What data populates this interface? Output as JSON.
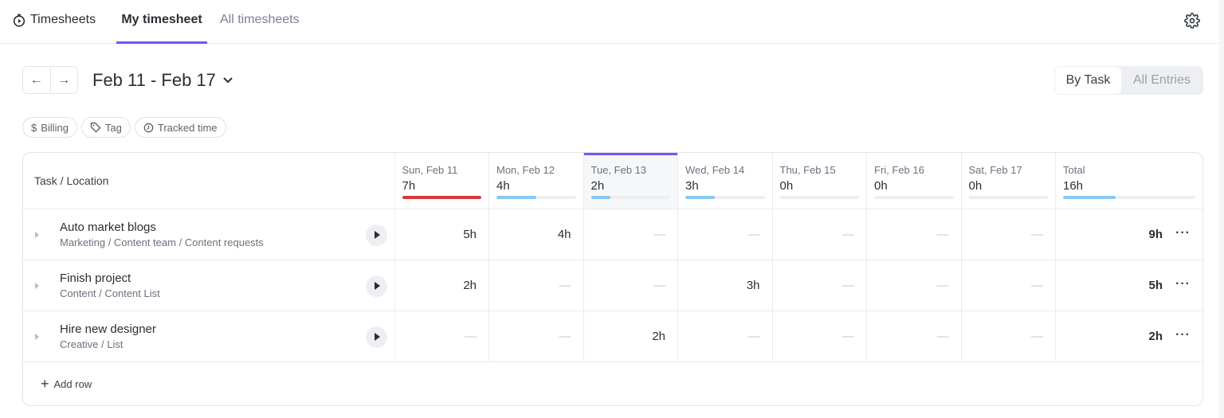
{
  "app": {
    "title": "Timesheets",
    "tabs": [
      "My timesheet",
      "All timesheets"
    ]
  },
  "toolbar": {
    "date_range": "Feb 11 - Feb 17",
    "view_by_task": "By Task",
    "view_all_entries": "All Entries"
  },
  "filters": [
    "Billing",
    "Tag",
    "Tracked time"
  ],
  "filter_icons": [
    "$"
  ],
  "table": {
    "task_header": "Task / Location",
    "days": [
      {
        "label": "Sun, Feb 11",
        "total": "7h",
        "progress": 1.0,
        "color": "#d9383a"
      },
      {
        "label": "Mon, Feb 12",
        "total": "4h",
        "progress": 0.5,
        "color": "#86c9f0"
      },
      {
        "label": "Tue, Feb 13",
        "total": "2h",
        "progress": 0.25,
        "color": "#86c9f0"
      },
      {
        "label": "Wed, Feb 14",
        "total": "3h",
        "progress": 0.375,
        "color": "#86c9f0"
      },
      {
        "label": "Thu, Feb 15",
        "total": "0h",
        "progress": 0,
        "color": "#86c9f0"
      },
      {
        "label": "Fri, Feb 16",
        "total": "0h",
        "progress": 0,
        "color": "#86c9f0"
      },
      {
        "label": "Sat, Feb 17",
        "total": "0h",
        "progress": 0,
        "color": "#86c9f0"
      }
    ],
    "total": {
      "label": "Total",
      "value": "16h",
      "progress": 0.4
    },
    "rows": [
      {
        "name": "Auto market blogs",
        "location": "Marketing / Content team / Content requests",
        "cells": [
          "5h",
          "4h",
          "—",
          "—",
          "—",
          "—",
          "—"
        ],
        "total": "9h"
      },
      {
        "name": "Finish project",
        "location": "Content / Content List",
        "cells": [
          "2h",
          "—",
          "—",
          "3h",
          "—",
          "—",
          "—"
        ],
        "total": "5h"
      },
      {
        "name": "Hire new designer",
        "location": "Creative / List",
        "cells": [
          "—",
          "—",
          "2h",
          "—",
          "—",
          "—",
          "—"
        ],
        "total": "2h"
      }
    ],
    "add_row": "Add row",
    "more": "···"
  },
  "accent": "#6b5cf0"
}
